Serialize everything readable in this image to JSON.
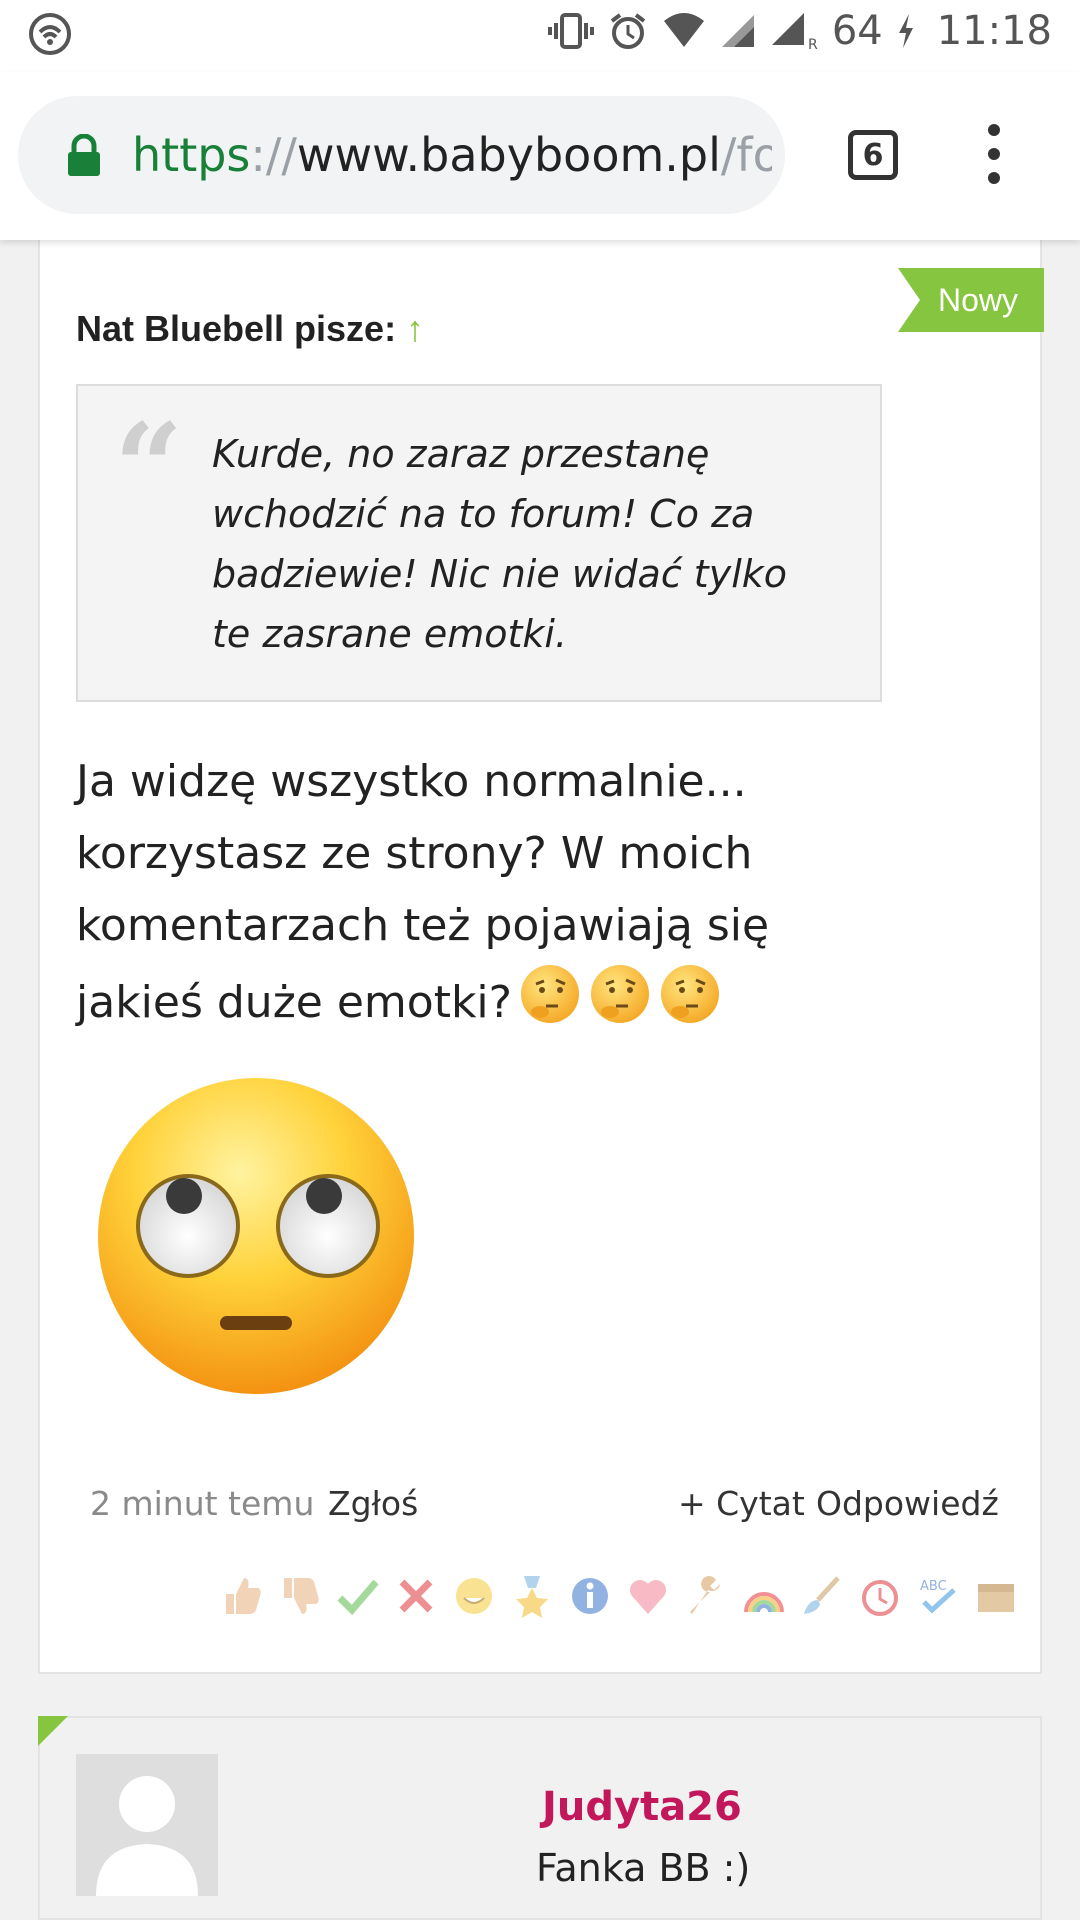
{
  "status_bar": {
    "battery": "64",
    "time": "11:18"
  },
  "browser": {
    "url_scheme": "https",
    "url_sep": "://",
    "url_host": "www.babyboom.pl",
    "url_rest": "/fo",
    "tab_count": "6"
  },
  "post": {
    "badge": "Nowy",
    "quote_author": "Nat Bluebell pisze:",
    "quote_arrow": "↑",
    "quote_text": "Kurde, no zaraz przestanę wchodzić na to forum! Co za badziewie! Nic nie widać tylko te zasrane emotki.",
    "body_text": "Ja widzę wszystko normalnie... korzystasz ze strony? W moich komentarzach też pojawiają się jakieś duże emotki?",
    "inline_emojis": [
      "thinking-face",
      "thinking-face",
      "thinking-face"
    ],
    "big_emoji": "face-with-rolling-eyes",
    "time_ago": "2 minut temu",
    "report_label": "Zgłoś",
    "quote_label": "+ Cytat",
    "reply_label": "Odpowiedź",
    "reactions": [
      "thumbs-up",
      "thumbs-down",
      "check",
      "cross",
      "smile",
      "medal",
      "info",
      "heart",
      "wrench",
      "rainbow",
      "brush",
      "alarm-clock",
      "spellcheck",
      "box"
    ]
  },
  "next_post": {
    "username": "Judyta26",
    "rank": "Fanka BB :)"
  },
  "colors": {
    "accent_green": "#86c540",
    "username_pink": "#c2185b",
    "url_green": "#188038"
  }
}
